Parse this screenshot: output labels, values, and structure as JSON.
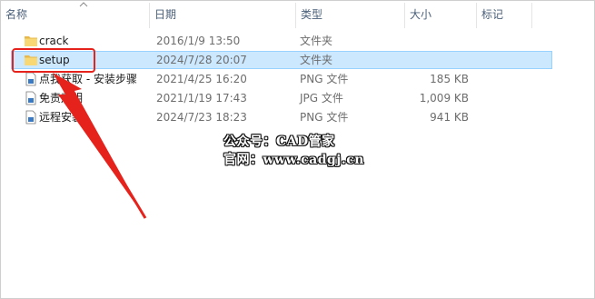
{
  "columns": {
    "name": "名称",
    "date": "日期",
    "type": "类型",
    "size": "大小",
    "tags": "标记"
  },
  "files": [
    {
      "name": "crack",
      "date": "2016/1/9 13:50",
      "type": "文件夹",
      "size": "",
      "icon": "folder-icon",
      "selected": false
    },
    {
      "name": "setup",
      "date": "2024/7/28 20:07",
      "type": "文件夹",
      "size": "",
      "icon": "folder-icon",
      "selected": true
    },
    {
      "name": "点我获取 - 安装步骤",
      "date": "2021/4/25 16:20",
      "type": "PNG 文件",
      "size": "185 KB",
      "icon": "image-file-icon",
      "selected": false
    },
    {
      "name": "免责声明",
      "date": "2021/1/19 17:43",
      "type": "JPG 文件",
      "size": "1,009 KB",
      "icon": "image-file-icon",
      "selected": false
    },
    {
      "name": "远程安装",
      "date": "2024/7/23 18:23",
      "type": "PNG 文件",
      "size": "941 KB",
      "icon": "image-file-icon",
      "selected": false
    }
  ],
  "watermark": {
    "line1": "公众号：CAD管家",
    "line2": "官网：www.cadgj.cn"
  },
  "colors": {
    "selection": "#cce8ff",
    "folder": "#f8d775",
    "annotation": "#e5231c"
  }
}
